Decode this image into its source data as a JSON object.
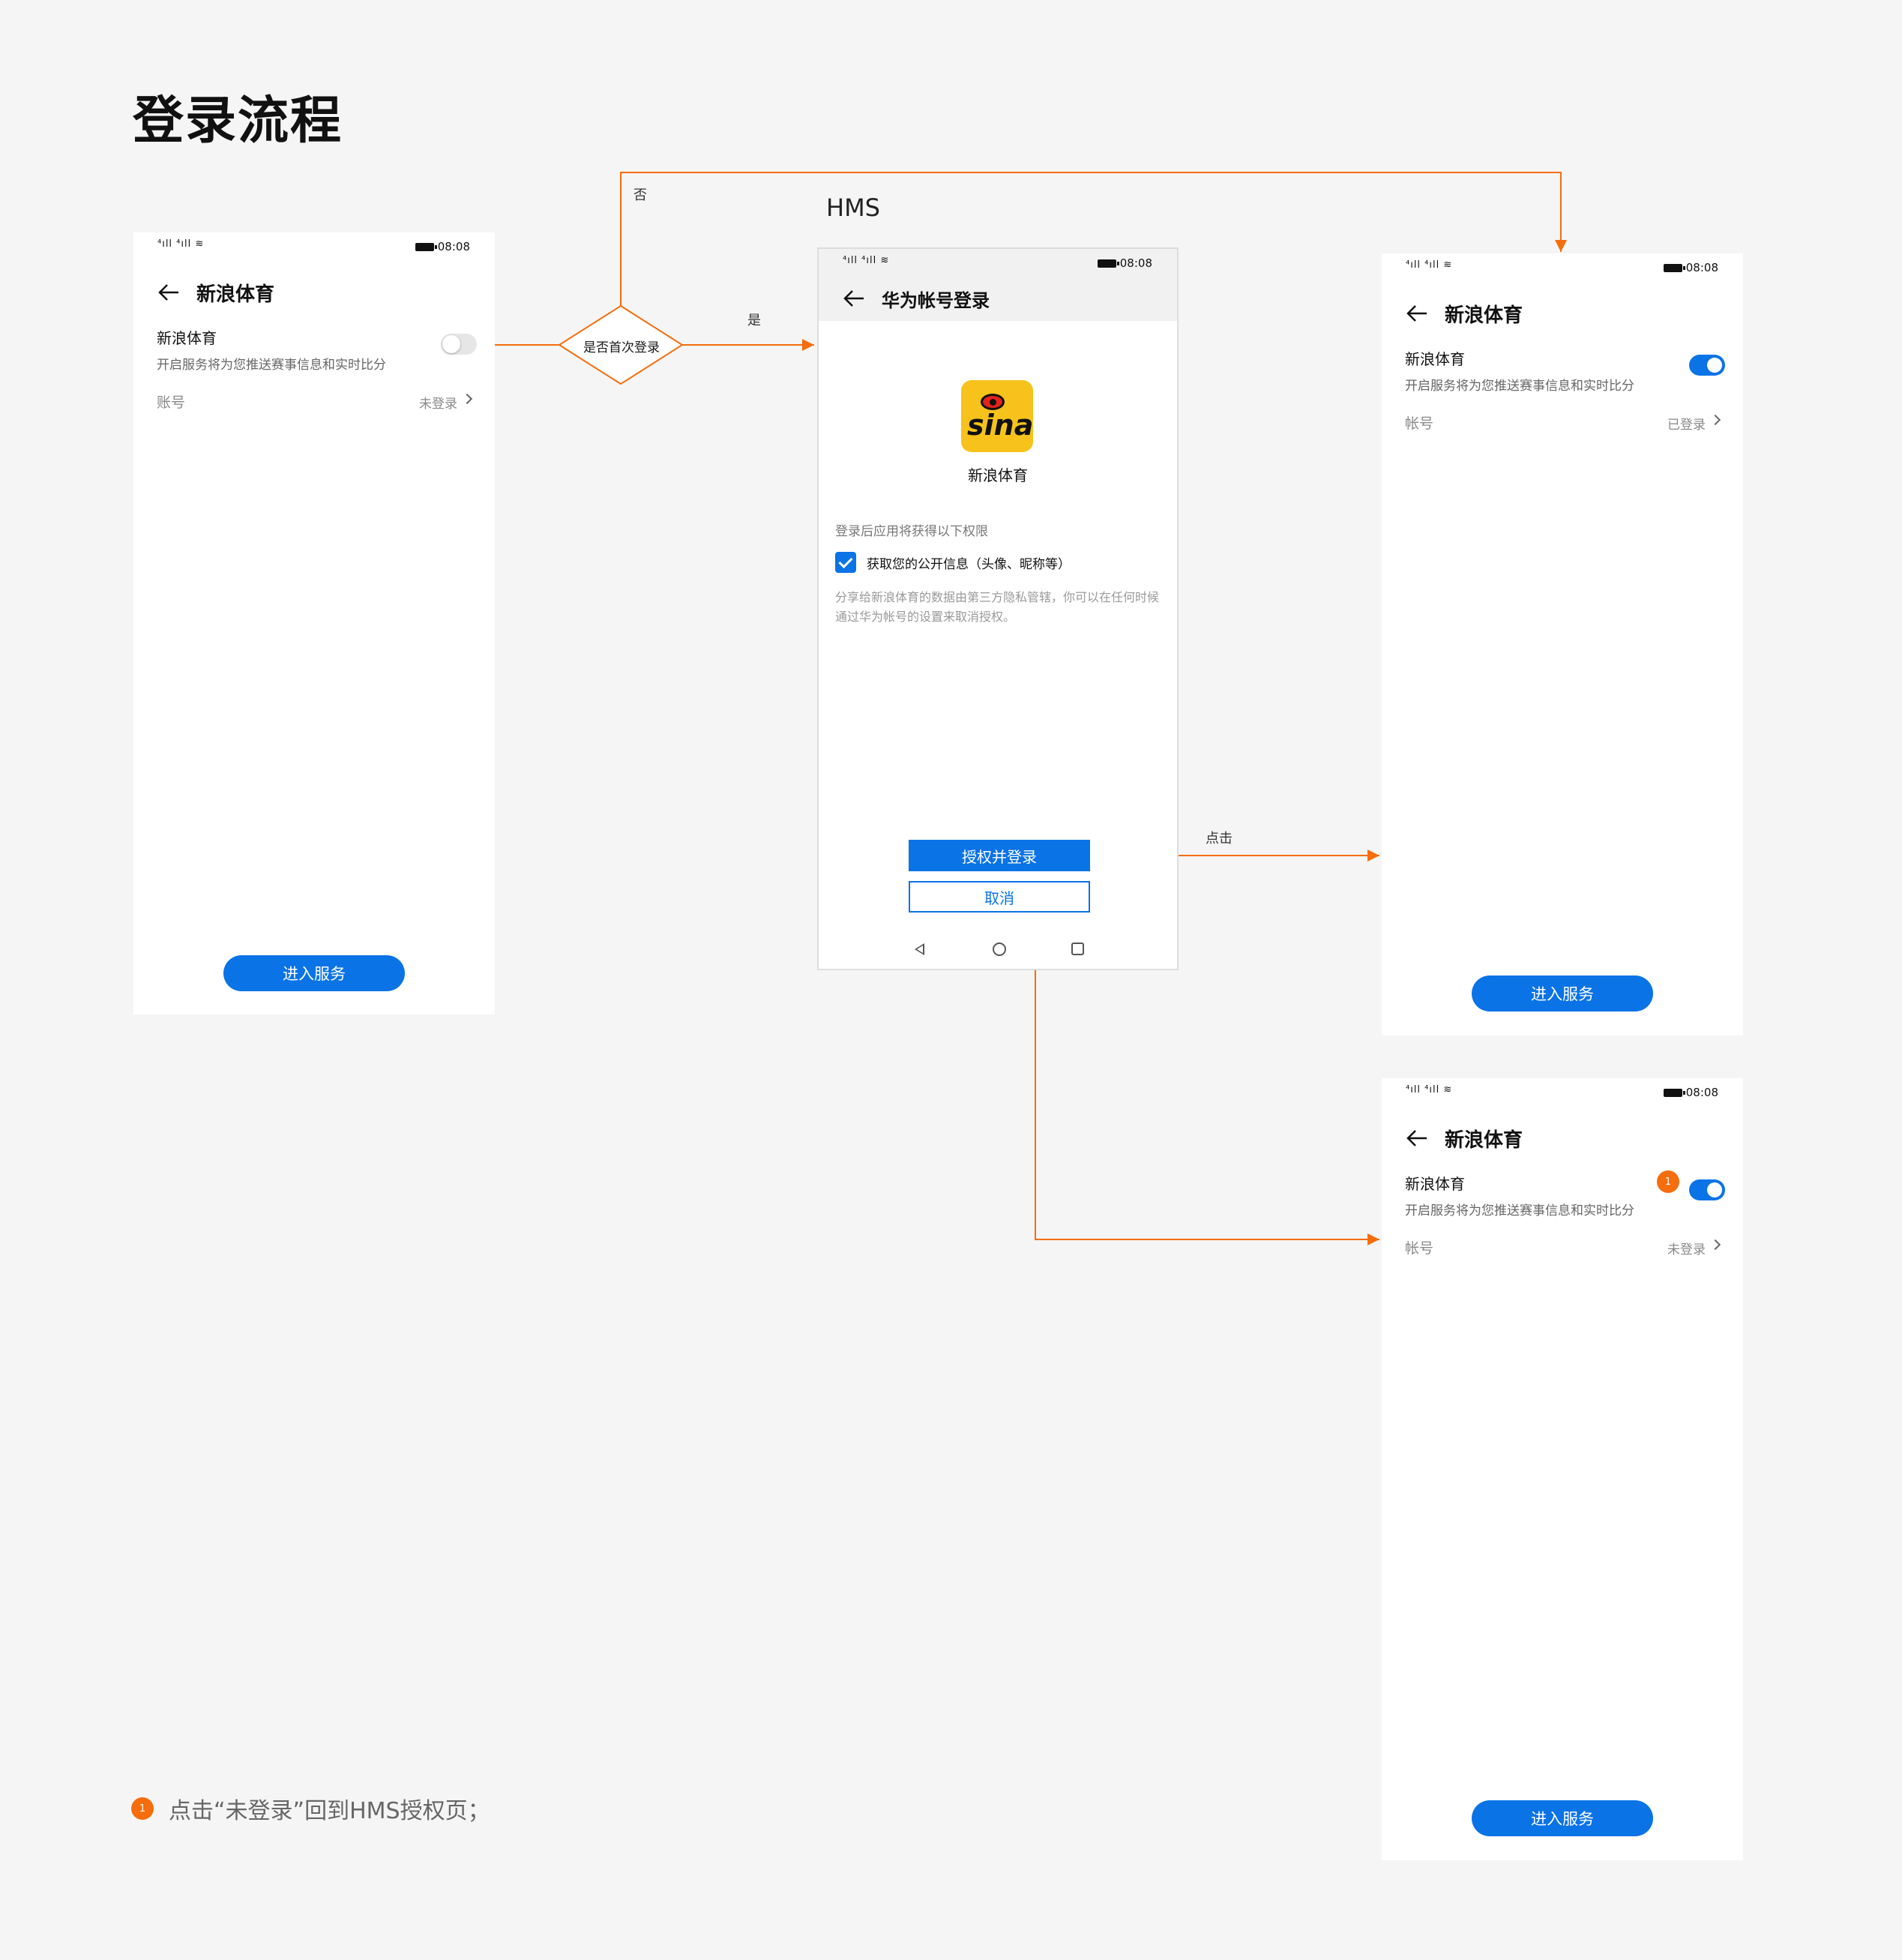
{
  "page": {
    "title": "登录流程"
  },
  "colors": {
    "flow_line": "#f56d0c",
    "accent_blue": "#0a73e6",
    "badge": "#f56d0c"
  },
  "flow": {
    "decision": "是否首次登录",
    "yes_label": "是",
    "no_label": "否",
    "click_label": "点击",
    "hms_label": "HMS"
  },
  "screen_initial": {
    "time": "08:08",
    "title": "新浪体育",
    "service_name": "新浪体育",
    "service_desc": "开启服务将为您推送赛事信息和实时比分",
    "toggle_on": false,
    "account_label": "账号",
    "account_value": "未登录",
    "enter_button": "进入服务"
  },
  "screen_hms": {
    "time": "08:08",
    "title": "华为帐号登录",
    "app_logo_text": "sina",
    "app_name": "新浪体育",
    "permissions_title": "登录后应用将获得以下权限",
    "permission_item": "获取您的公开信息（头像、昵称等）",
    "permission_checked": true,
    "permission_note": "分享给新浪体育的数据由第三方隐私管辖，你可以在任何时候通过华为帐号的设置来取消授权。",
    "authorize_button": "授权并登录",
    "cancel_button": "取消"
  },
  "screen_logged_in": {
    "time": "08:08",
    "title": "新浪体育",
    "service_name": "新浪体育",
    "service_desc": "开启服务将为您推送赛事信息和实时比分",
    "toggle_on": true,
    "account_label": "帐号",
    "account_value": "已登录",
    "enter_button": "进入服务"
  },
  "screen_cancelled": {
    "time": "08:08",
    "title": "新浪体育",
    "service_name": "新浪体育",
    "service_desc": "开启服务将为您推送赛事信息和实时比分",
    "toggle_on": true,
    "badge": "1",
    "account_label": "帐号",
    "account_value": "未登录",
    "enter_button": "进入服务"
  },
  "footnote": {
    "badge": "1",
    "text": "点击“未登录”回到HMS授权页；"
  }
}
